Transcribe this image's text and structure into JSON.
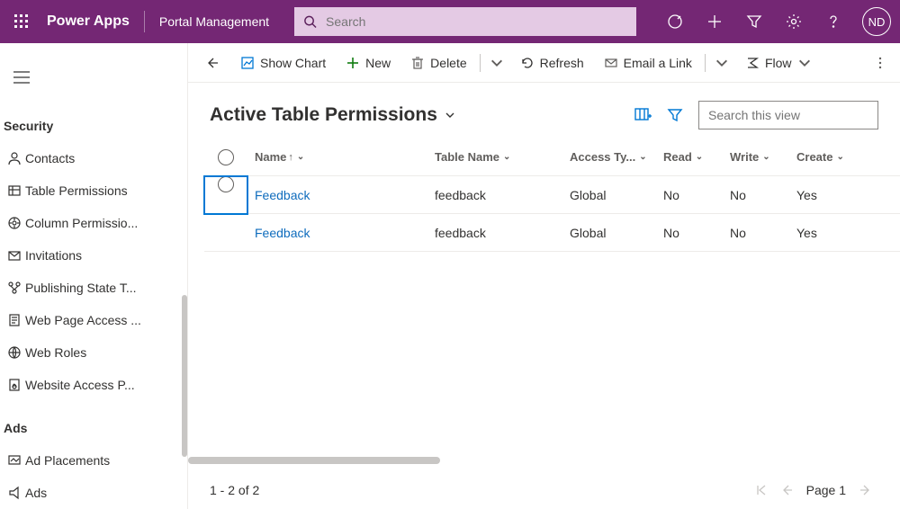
{
  "header": {
    "brand": "Power Apps",
    "portal": "Portal Management",
    "search_placeholder": "Search",
    "avatar": "ND"
  },
  "sidebar": {
    "sections": [
      {
        "title": "Security",
        "items": [
          {
            "label": "Contacts"
          },
          {
            "label": "Table Permissions"
          },
          {
            "label": "Column Permissio..."
          },
          {
            "label": "Invitations"
          },
          {
            "label": "Publishing State T..."
          },
          {
            "label": "Web Page Access ..."
          },
          {
            "label": "Web Roles"
          },
          {
            "label": "Website Access P..."
          }
        ]
      },
      {
        "title": "Ads",
        "items": [
          {
            "label": "Ad Placements"
          },
          {
            "label": "Ads"
          }
        ]
      }
    ],
    "selected_index": 1
  },
  "commandbar": {
    "show_chart": "Show Chart",
    "new": "New",
    "delete": "Delete",
    "refresh": "Refresh",
    "email": "Email a Link",
    "flow": "Flow"
  },
  "view": {
    "title": "Active Table Permissions",
    "search_placeholder": "Search this view"
  },
  "grid": {
    "columns": {
      "name": "Name",
      "table": "Table Name",
      "access": "Access Ty...",
      "read": "Read",
      "write": "Write",
      "create": "Create"
    },
    "rows": [
      {
        "name": "Feedback",
        "table": "feedback",
        "access": "Global",
        "read": "No",
        "write": "No",
        "create": "Yes"
      },
      {
        "name": "Feedback",
        "table": "feedback",
        "access": "Global",
        "read": "No",
        "write": "No",
        "create": "Yes"
      }
    ],
    "selected_row": 0
  },
  "footer": {
    "status": "1 - 2 of 2",
    "page": "Page 1"
  }
}
